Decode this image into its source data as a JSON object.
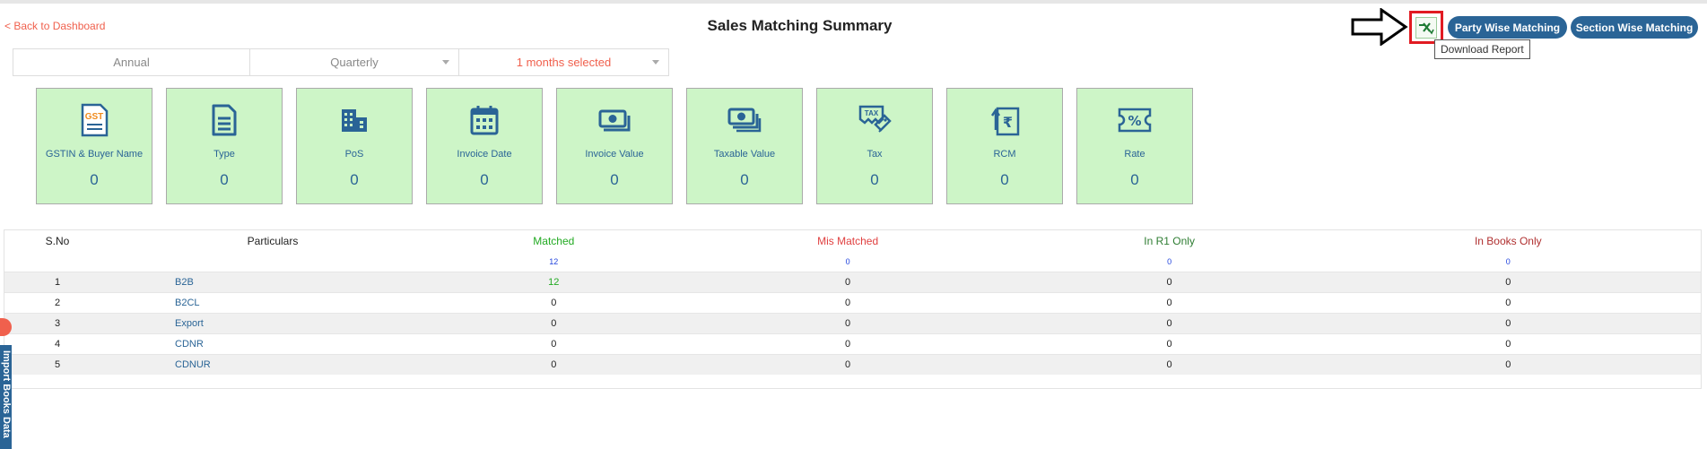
{
  "header": {
    "back_label": "< Back to Dashboard",
    "title": "Sales Matching Summary",
    "download_tooltip": "Download Report",
    "party_btn": "Party Wise Matching",
    "section_btn": "Section Wise Matching"
  },
  "period": {
    "annual": "Annual",
    "quarterly": "Quarterly",
    "months": "1 months selected"
  },
  "cards": [
    {
      "label": "GSTIN & Buyer Name",
      "value": "0",
      "icon": "gst-doc-icon"
    },
    {
      "label": "Type",
      "value": "0",
      "icon": "document-icon"
    },
    {
      "label": "PoS",
      "value": "0",
      "icon": "building-icon"
    },
    {
      "label": "Invoice Date",
      "value": "0",
      "icon": "calendar-icon"
    },
    {
      "label": "Invoice Value",
      "value": "0",
      "icon": "cash-icon"
    },
    {
      "label": "Taxable Value",
      "value": "0",
      "icon": "cash-stack-icon"
    },
    {
      "label": "Tax",
      "value": "0",
      "icon": "tax-tag-icon"
    },
    {
      "label": "RCM",
      "value": "0",
      "icon": "rupee-doc-icon"
    },
    {
      "label": "Rate",
      "value": "0",
      "icon": "percent-ticket-icon"
    }
  ],
  "table": {
    "headers": {
      "sno": "S.No",
      "particulars": "Particulars",
      "matched": "Matched",
      "mis_matched": "Mis Matched",
      "in_r1": "In R1 Only",
      "in_books": "In Books Only"
    },
    "totals": {
      "matched": "12",
      "mis_matched": "0",
      "in_r1": "0",
      "in_books": "0"
    },
    "rows": [
      {
        "sno": "1",
        "particular": "B2B",
        "matched": "12",
        "mis_matched": "0",
        "in_r1": "0",
        "in_books": "0"
      },
      {
        "sno": "2",
        "particular": "B2CL",
        "matched": "0",
        "mis_matched": "0",
        "in_r1": "0",
        "in_books": "0"
      },
      {
        "sno": "3",
        "particular": "Export",
        "matched": "0",
        "mis_matched": "0",
        "in_r1": "0",
        "in_books": "0"
      },
      {
        "sno": "4",
        "particular": "CDNR",
        "matched": "0",
        "mis_matched": "0",
        "in_r1": "0",
        "in_books": "0"
      },
      {
        "sno": "5",
        "particular": "CDNUR",
        "matched": "0",
        "mis_matched": "0",
        "in_r1": "0",
        "in_books": "0"
      }
    ]
  },
  "side_tab": {
    "label": "Import Books Data"
  },
  "colors": {
    "accent": "#2a6496",
    "card_bg": "#cdf5c7",
    "highlight": "#e11b22",
    "link": "#f0604d"
  }
}
